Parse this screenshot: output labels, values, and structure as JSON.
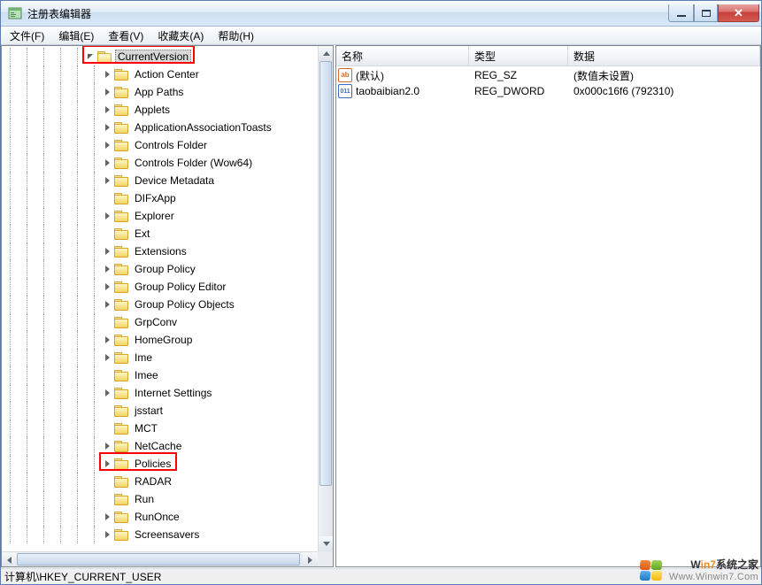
{
  "window": {
    "title": "注册表编辑器"
  },
  "menu": {
    "file": "文件(F)",
    "edit": "编辑(E)",
    "view": "查看(V)",
    "favorites": "收藏夹(A)",
    "help": "帮助(H)"
  },
  "tree": {
    "root": "CurrentVersion",
    "items": [
      "Action Center",
      "App Paths",
      "Applets",
      "ApplicationAssociationToasts",
      "Controls Folder",
      "Controls Folder (Wow64)",
      "Device Metadata",
      "DIFxApp",
      "Explorer",
      "Ext",
      "Extensions",
      "Group Policy",
      "Group Policy Editor",
      "Group Policy Objects",
      "GrpConv",
      "HomeGroup",
      "Ime",
      "Imee",
      "Internet Settings",
      "jsstart",
      "MCT",
      "NetCache",
      "Policies",
      "RADAR",
      "Run",
      "RunOnce",
      "Screensavers"
    ],
    "highlighted": [
      "CurrentVersion",
      "Policies"
    ],
    "no_expander": [
      "DIFxApp",
      "Ext",
      "GrpConv",
      "Imee",
      "jsstart",
      "MCT",
      "RADAR",
      "Run"
    ]
  },
  "list": {
    "headers": {
      "name": "名称",
      "type": "类型",
      "data": "数据"
    },
    "rows": [
      {
        "icon": "str",
        "name": "(默认)",
        "type": "REG_SZ",
        "data": "(数值未设置)"
      },
      {
        "icon": "bin",
        "name": "taobaibian2.0",
        "type": "REG_DWORD",
        "data": "0x000c16f6 (792310)"
      }
    ]
  },
  "icons": {
    "str_glyph": "ab",
    "bin_glyph": "011"
  },
  "statusbar": {
    "path": "计算机\\HKEY_CURRENT_USER"
  },
  "watermark": {
    "line1a": "W",
    "line1b": "in7",
    "line1c": "系统之家",
    "line2": "Www.Winwin7.Com"
  }
}
